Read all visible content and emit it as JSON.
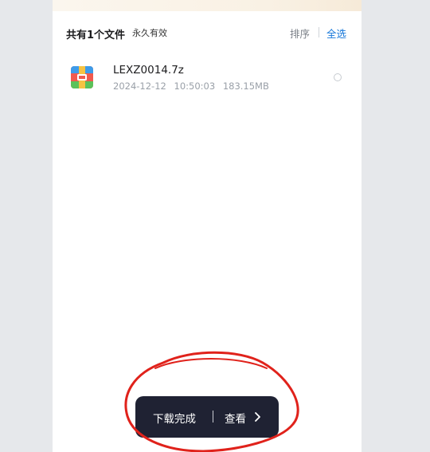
{
  "header": {
    "file_count": "共有1个文件",
    "validity": "永久有效",
    "sort_label": "排序",
    "select_all_label": "全选"
  },
  "files": [
    {
      "name": "LEXZ0014.7z",
      "date": "2024-12-12",
      "time": "10:50:03",
      "size": "183.15MB",
      "icon": "archive-icon",
      "selected": false
    }
  ],
  "toast": {
    "message": "下载完成",
    "action_label": "查看",
    "action_icon": "chevron-right-icon"
  },
  "colors": {
    "accent": "#1677d9",
    "toast_bg": "#1f2233",
    "annotation": "#e0221b"
  }
}
